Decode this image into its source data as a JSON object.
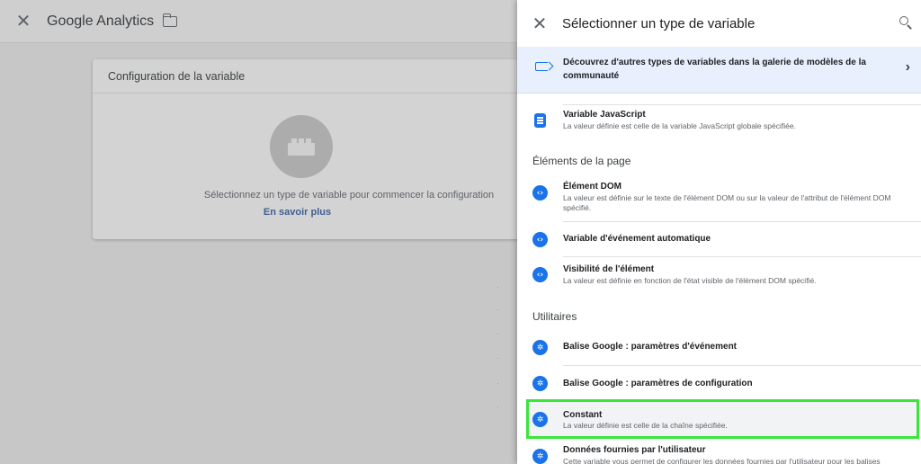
{
  "background": {
    "title": "Google Analytics",
    "card_title": "Configuration de la variable",
    "hint": "Sélectionnez un type de variable pour commencer la configuration",
    "learn_more": "En savoir plus"
  },
  "panel": {
    "title": "Sélectionner un type de variable",
    "banner": "Découvrez d'autres types de variables dans la galerie de modèles de la communauté",
    "items": [
      {
        "name": "Variable JavaScript",
        "desc": "La valeur définie est celle de la variable JavaScript globale spécifiée.",
        "icon": "document-icon"
      },
      {
        "name": "Élément DOM",
        "desc": "La valeur est définie sur le texte de l'élément DOM ou sur la valeur de l'attribut de l'élément DOM spécifié.",
        "icon": "code-icon"
      },
      {
        "name": "Variable d'événement automatique",
        "desc": "",
        "icon": "code-icon"
      },
      {
        "name": "Visibilité de l'élément",
        "desc": "La valeur est définie en fonction de l'état visible de l'élément DOM spécifié.",
        "icon": "code-icon"
      },
      {
        "name": "Balise Google : paramètres d'événement",
        "desc": "",
        "icon": "gear-icon"
      },
      {
        "name": "Balise Google : paramètres de configuration",
        "desc": "",
        "icon": "gear-icon"
      },
      {
        "name": "Constant",
        "desc": "La valeur définie est celle de la chaîne spécifiée.",
        "icon": "gear-icon"
      },
      {
        "name": "Données fournies par l'utilisateur",
        "desc": "Cette variable vous permet de configurer les données fournies par l'utilisateur pour les balises",
        "icon": "gear-icon"
      }
    ],
    "sections": {
      "page_elements": "Éléments de la page",
      "utilities": "Utilitaires"
    }
  },
  "colors": {
    "accent": "#1a73e8",
    "highlight": "#39e63a",
    "banner_bg": "#e8f0fe"
  }
}
